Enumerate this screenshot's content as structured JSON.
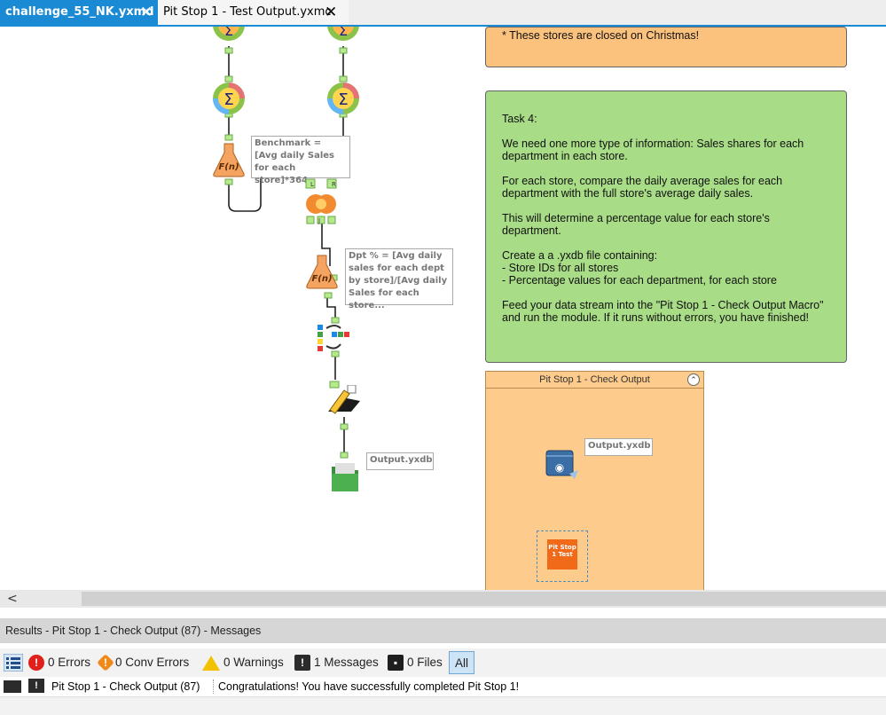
{
  "tabs": [
    {
      "label": "challenge_55_NK.yxmd",
      "active": true
    },
    {
      "label": "Pit Stop 1 - Test Output.yxmc",
      "active": false
    }
  ],
  "tab_close_glyph": "✕",
  "workflow": {
    "annotations": {
      "benchmark": "Benchmark = [Avg daily Sales for each store]*364",
      "dpt_pct": "Dpt % = [Avg daily sales for each dept by store]/[Avg daily Sales for each store...",
      "output1": "Output.yxdb",
      "output2": "Output.yxdb"
    },
    "tool_labels": {
      "formula1": "F(n)",
      "formula2": "F(n)",
      "join_l": "L",
      "join_r": "R",
      "join_j": "J",
      "macro_test": "Pit Stop 1 Test"
    }
  },
  "notes": {
    "orange_text": "* These stores are closed on Christmas!",
    "task4": [
      "Task 4:",
      "We need one more type of information: Sales shares for each department in each store.",
      "For each store, compare the daily average sales for each department with the full store's average daily sales.",
      "This will determine a percentage value for each store's department.",
      "Create a  a .yxdb file containing:\n- Store IDs for all stores\n- Percentage values for each department, for each store",
      "Feed your data stream into the \"Pit Stop 1 - Check Output Macro\" and run the module. If it runs without errors, you have finished!"
    ]
  },
  "container": {
    "title": "Pit Stop 1 - Check Output",
    "collapse_glyph": "⌃"
  },
  "scrollbar": {
    "left_arrow": "<"
  },
  "results": {
    "title": "Results - Pit Stop 1 - Check Output (87) - Messages",
    "filters": {
      "errors": "0 Errors",
      "conv_errors": "0 Conv Errors",
      "warnings": "0 Warnings",
      "messages": "1 Messages",
      "files": "0 Files",
      "all": "All"
    },
    "message": {
      "tool": "Pit Stop 1 - Check Output (87)",
      "text": "Congratulations!  You have successfully completed Pit Stop 1!"
    }
  },
  "colors": {
    "accent": "#1a8ad4",
    "note_green": "#a8dc86",
    "note_orange": "#fbc27e",
    "container": "#fdcc8c"
  }
}
